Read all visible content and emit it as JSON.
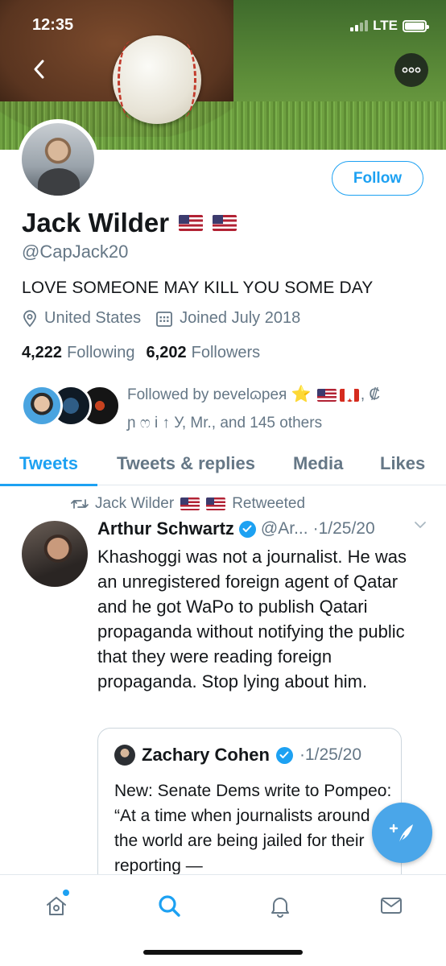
{
  "status_bar": {
    "time": "12:35",
    "network": "LTE"
  },
  "header": {
    "back_icon": "chevron-left-icon",
    "more_icon": "more-dots-icon"
  },
  "profile": {
    "display_name": "Jack Wilder",
    "handle": "@CapJack20",
    "bio": "LOVE SOMEONE MAY KILL YOU SOME DAY",
    "location": "United States",
    "joined": "Joined July 2018",
    "following_count": "4,222",
    "following_label": "Following",
    "followers_count": "6,202",
    "followers_label": "Followers",
    "follow_button": "Follow",
    "followed_by": {
      "prefix": "Followed by",
      "name1": "ɒevelɷpeя",
      "sep": ", ₡",
      "line2": "ɲ ෆ і ↑ У, Mr., and 145 others"
    }
  },
  "tabs": [
    {
      "label": "Tweets",
      "active": true
    },
    {
      "label": "Tweets & replies",
      "active": false
    },
    {
      "label": "Media",
      "active": false
    },
    {
      "label": "Likes",
      "active": false
    }
  ],
  "tweet": {
    "retweeted_by": "Jack Wilder",
    "retweeted_label": "Retweeted",
    "author": "Arthur Schwartz",
    "handle": "@Ar...",
    "date": "·1/25/20",
    "text": "Khashoggi was not a journalist. He was an unregistered foreign agent of Qatar and he got WaPo to publish Qatari propaganda without notifying the public that they were reading foreign propaganda. Stop lying about him.",
    "quote": {
      "author": "Zachary Cohen",
      "date": "·1/25/20",
      "text": "New: Senate Dems write to Pompeo: “At a time when journalists around the world are being jailed for their reporting —"
    }
  },
  "bottom_nav": [
    "home-icon",
    "search-icon",
    "notifications-icon",
    "messages-icon"
  ],
  "colors": {
    "accent": "#1da1f2",
    "text": "#14171a",
    "muted": "#657786"
  }
}
